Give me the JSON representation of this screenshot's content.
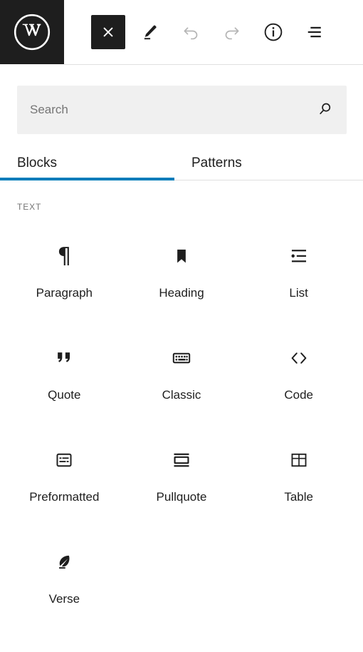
{
  "header": {
    "logo_icon": "wordpress-logo-icon",
    "buttons": [
      {
        "name": "close-inserter-button",
        "icon": "close-x-icon",
        "label": "Close block inserter",
        "state": "active"
      },
      {
        "name": "edit-mode-button",
        "icon": "pencil-edit-icon",
        "label": "Edit",
        "state": "enabled"
      },
      {
        "name": "undo-button",
        "icon": "undo-arrow-icon",
        "label": "Undo",
        "state": "disabled"
      },
      {
        "name": "redo-button",
        "icon": "redo-arrow-icon",
        "label": "Redo",
        "state": "disabled"
      },
      {
        "name": "details-button",
        "icon": "info-circle-icon",
        "label": "Details",
        "state": "enabled"
      },
      {
        "name": "list-view-button",
        "icon": "list-view-icon",
        "label": "List view",
        "state": "enabled"
      }
    ]
  },
  "search": {
    "placeholder": "Search",
    "value": "",
    "icon": "search-magnifier-icon"
  },
  "tabs": [
    {
      "label": "Blocks",
      "active": true
    },
    {
      "label": "Patterns",
      "active": false
    }
  ],
  "category": {
    "title": "TEXT"
  },
  "blocks": [
    {
      "label": "Paragraph",
      "icon": "paragraph-pilcrow-icon"
    },
    {
      "label": "Heading",
      "icon": "heading-bookmark-icon"
    },
    {
      "label": "List",
      "icon": "list-bullets-icon"
    },
    {
      "label": "Quote",
      "icon": "quote-marks-icon"
    },
    {
      "label": "Classic",
      "icon": "classic-keyboard-icon"
    },
    {
      "label": "Code",
      "icon": "code-brackets-icon"
    },
    {
      "label": "Preformatted",
      "icon": "preformatted-box-icon"
    },
    {
      "label": "Pullquote",
      "icon": "pullquote-box-icon"
    },
    {
      "label": "Table",
      "icon": "table-grid-icon"
    },
    {
      "label": "Verse",
      "icon": "verse-feather-icon"
    }
  ],
  "colors": {
    "accent_blue": "#007cba",
    "dark": "#1e1e1e",
    "search_bg": "#f0f0f0",
    "muted_text": "#757575",
    "disabled_icon": "#b0b0b0",
    "border": "#e0e0e0"
  }
}
